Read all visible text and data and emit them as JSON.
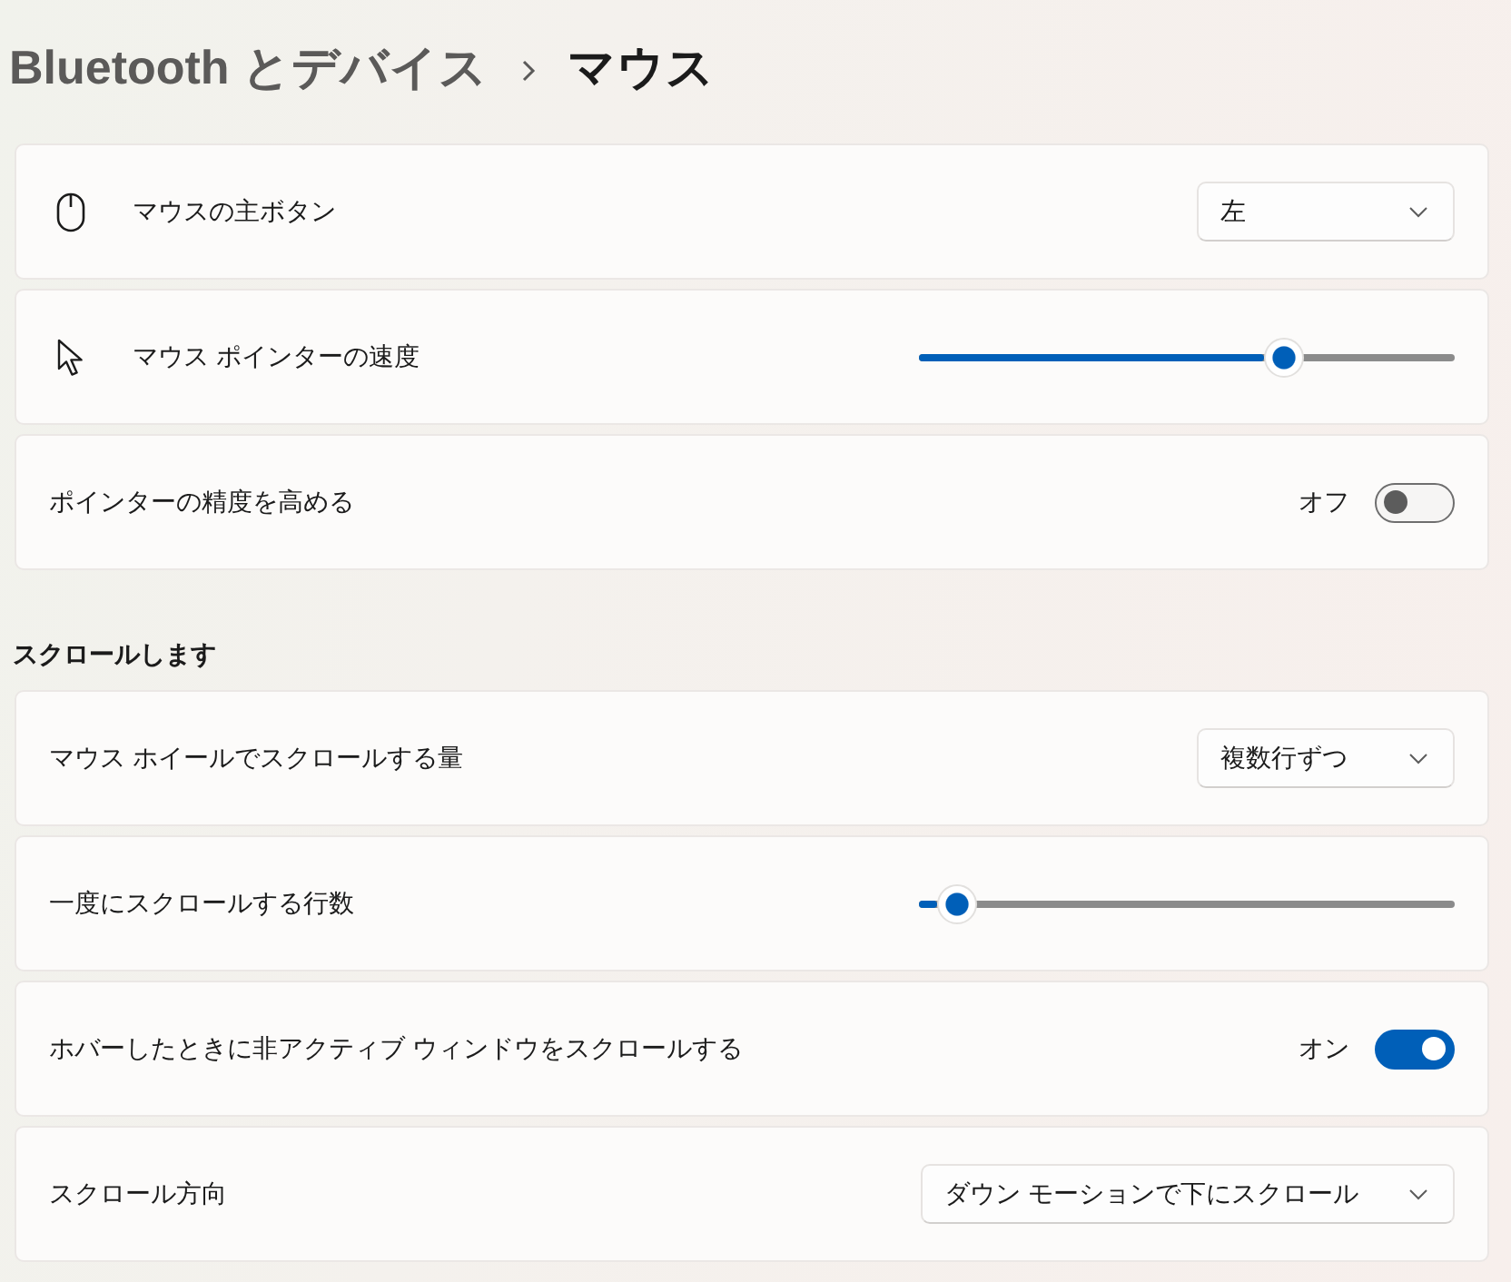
{
  "breadcrumb": [
    {
      "label": "Bluetooth とデバイス",
      "current": false
    },
    {
      "label": "マウス",
      "current": true
    }
  ],
  "sections": [
    {
      "settings": [
        {
          "kind": "dropdown",
          "label": "マウスの主ボタン",
          "value": "左"
        },
        {
          "kind": "slider",
          "label": "マウス ポインターの速度",
          "level": 0.68
        },
        {
          "kind": "toggle",
          "label": "ポインターの精度を高める",
          "state_label": "オフ",
          "on": false
        }
      ]
    },
    {
      "heading": "スクロールします",
      "settings": [
        {
          "kind": "dropdown",
          "label": "マウス ホイールでスクロールする量",
          "value": "複数行ずつ"
        },
        {
          "kind": "slider",
          "label": "一度にスクロールする行数",
          "level": 0.07
        },
        {
          "kind": "toggle",
          "label": "ホバーしたときに非アクティブ ウィンドウをスクロールする",
          "state_label": "オン",
          "on": true
        },
        {
          "kind": "dropdown",
          "label": "スクロール方向",
          "value": "ダウン モーションで下にスクロール"
        }
      ]
    }
  ]
}
